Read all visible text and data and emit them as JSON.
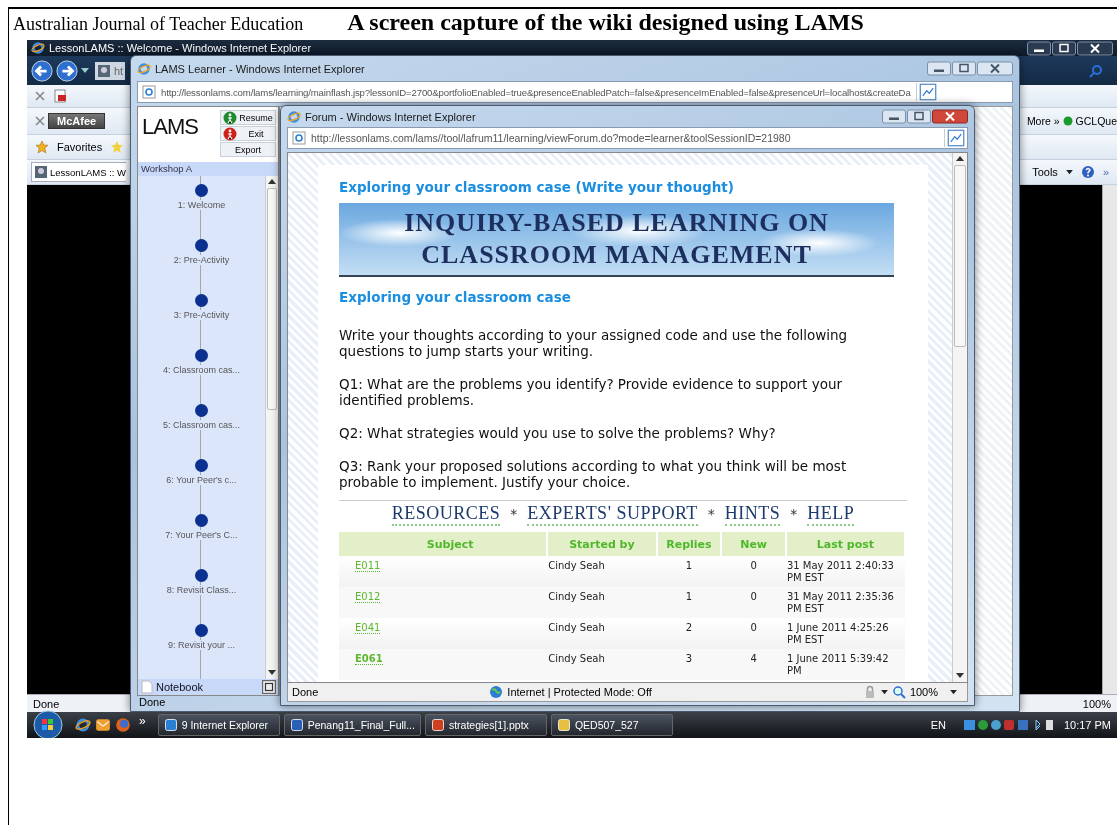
{
  "page_header": {
    "journal": "Australian Journal of Teacher Education",
    "caption": "A screen capture of the wiki designed using LAMS"
  },
  "back_window": {
    "title": "LessonLAMS :: Welcome - Windows Internet Explorer",
    "address": "ht",
    "toolbar_brand": "McAfee",
    "links_more": "More »",
    "link_item": "GCLQue",
    "favorites": "Favorites",
    "tab": "LessonLAMS :: W",
    "tools": "Tools",
    "more_chevron": "»",
    "status": "Done",
    "zoom": "100%"
  },
  "lams_window": {
    "title": "LAMS Learner - Windows Internet Explorer",
    "url": "http://lessonlams.com/lams/learning/mainflash.jsp?lessonID=2700&portfolioEnabled=true&presenceEnabledPatch=false&presenceImEnabled=false&presenceUrl=localhost&createDa",
    "logo": "LAMS",
    "buttons": [
      {
        "kind": "resume",
        "label": "Resume"
      },
      {
        "kind": "exit",
        "label": "Exit"
      },
      {
        "kind": "plain",
        "label": "Export"
      }
    ],
    "workshop": "Workshop A",
    "activities": [
      "1: Welcome",
      "2: Pre-Activity",
      "3: Pre-Activity",
      "4: Classroom cas...",
      "5: Classroom cas...",
      "6: Your Peer's c...",
      "7: Your Peer's C...",
      "8: Revisit Class...",
      "9: Revisit your ..."
    ],
    "notebook": "Notebook",
    "status": "Done"
  },
  "forum_window": {
    "title": "Forum - Windows Internet Explorer",
    "url": "http://lessonlams.com/lams//tool/lafrum11/learning/viewForum.do?mode=learner&toolSessionID=21980",
    "heading": "Exploring your classroom case (Write your thought)",
    "banner_lines": [
      "INQUIRY-BASED LEARNING ON",
      "CLASSROOM MANAGEMENT"
    ],
    "subheading": "Exploring your classroom case",
    "paragraphs": [
      "Write your thoughts  according to your assigned code and use the following questions to jump starts your writing.",
      "Q1: What are the problems you identify? Provide evidence to support your identified problems.",
      "Q2: What strategies would you use to solve the problems? Why?",
      "Q3: Rank your proposed solutions according to what you think will be most probable to implement. Justify your choice."
    ],
    "nav": [
      {
        "kind": "link",
        "text": "RESOURCES"
      },
      {
        "kind": "separator",
        "text": "*"
      },
      {
        "kind": "link",
        "text": "EXPERTS' SUPPORT"
      },
      {
        "kind": "separator",
        "text": "*"
      },
      {
        "kind": "link",
        "text": "HINTS"
      },
      {
        "kind": "separator",
        "text": "*"
      },
      {
        "kind": "link",
        "text": "HELP"
      }
    ],
    "table": {
      "columns": [
        "Subject",
        "Started by",
        "Replies",
        "New",
        "Last post"
      ],
      "rows": [
        {
          "subject": "E011",
          "started_by": "Cindy Seah",
          "replies": "1",
          "new": "0",
          "last_post": "31 May 2011 2:40:33 PM EST",
          "unread": false
        },
        {
          "subject": "E012",
          "started_by": "Cindy Seah",
          "replies": "1",
          "new": "0",
          "last_post": "31 May 2011 2:35:36 PM EST",
          "unread": false
        },
        {
          "subject": "E041",
          "started_by": "Cindy Seah",
          "replies": "2",
          "new": "0",
          "last_post": "1 June 2011 4:25:26 PM EST",
          "unread": false
        },
        {
          "subject": "E061",
          "started_by": "Cindy Seah",
          "replies": "3",
          "new": "4",
          "last_post": "1 June 2011 5:39:42 PM",
          "unread": true
        }
      ]
    },
    "status": "Done",
    "zone": "Internet | Protected Mode: Off",
    "zoom": "100%"
  },
  "taskbar": {
    "more": "»",
    "buttons": [
      {
        "kind": "ie",
        "label": "9 Internet Explorer"
      },
      {
        "kind": "word",
        "label": "Penang11_Final_Full..."
      },
      {
        "kind": "pptx",
        "label": "strategies[1].pptx"
      },
      {
        "kind": "folder",
        "label": "QED507_527"
      }
    ],
    "language": "EN",
    "clock": "10:17 PM"
  }
}
